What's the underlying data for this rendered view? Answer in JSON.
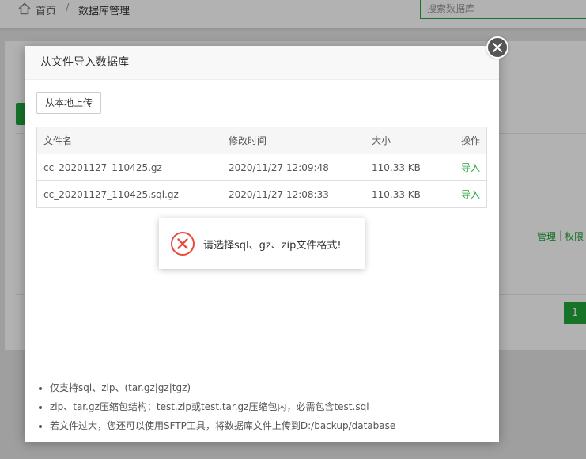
{
  "breadcrumb": {
    "home": "首页",
    "separator": "/",
    "current": "数据库管理"
  },
  "search": {
    "placeholder": "搜索数据库",
    "value": ""
  },
  "background": {
    "manage_link": "管理",
    "divider": "|",
    "permission_link": "权限",
    "page_current": "1"
  },
  "dialog": {
    "title": "从文件导入数据库",
    "upload_button": "从本地上传",
    "table": {
      "headers": [
        "文件名",
        "修改时间",
        "大小",
        "操作"
      ],
      "rows": [
        {
          "name": "cc_20201127_110425.gz",
          "mtime": "2020/11/27 12:09:48",
          "size": "110.33 KB",
          "action": "导入"
        },
        {
          "name": "cc_20201127_110425.sql.gz",
          "mtime": "2020/11/27 12:08:33",
          "size": "110.33 KB",
          "action": "导入"
        }
      ]
    },
    "notes": [
      "仅支持sql、zip、(tar.gz|gz|tgz)",
      "zip、tar.gz压缩包结构：test.zip或test.tar.gz压缩包内，必需包含test.sql",
      "若文件过大，您还可以使用SFTP工具，将数据库文件上传到D:/backup/database"
    ]
  },
  "toast": {
    "message": "请选择sql、gz、zip文件格式!",
    "icon": "error-x-icon",
    "color": "#e94a3d"
  },
  "colors": {
    "accent": "#20a53a",
    "error": "#e94a3d"
  }
}
